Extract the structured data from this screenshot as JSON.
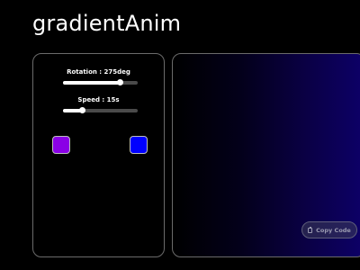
{
  "header": {
    "title": "gradientAnim"
  },
  "controls": {
    "rotation": {
      "label": "Rotation : 275deg",
      "value_deg": 275,
      "max_deg": 360
    },
    "speed": {
      "label": "Speed : 15s",
      "value_s": 15,
      "fraction": 0.26
    },
    "colors": {
      "start": "#8a00e6",
      "end": "#0000ff"
    }
  },
  "preview": {
    "copy_button_label": "Copy Code",
    "copy_icon": "clipboard-icon"
  },
  "theme": {
    "background": "#000000",
    "panel_border": "#6b6b6b"
  }
}
